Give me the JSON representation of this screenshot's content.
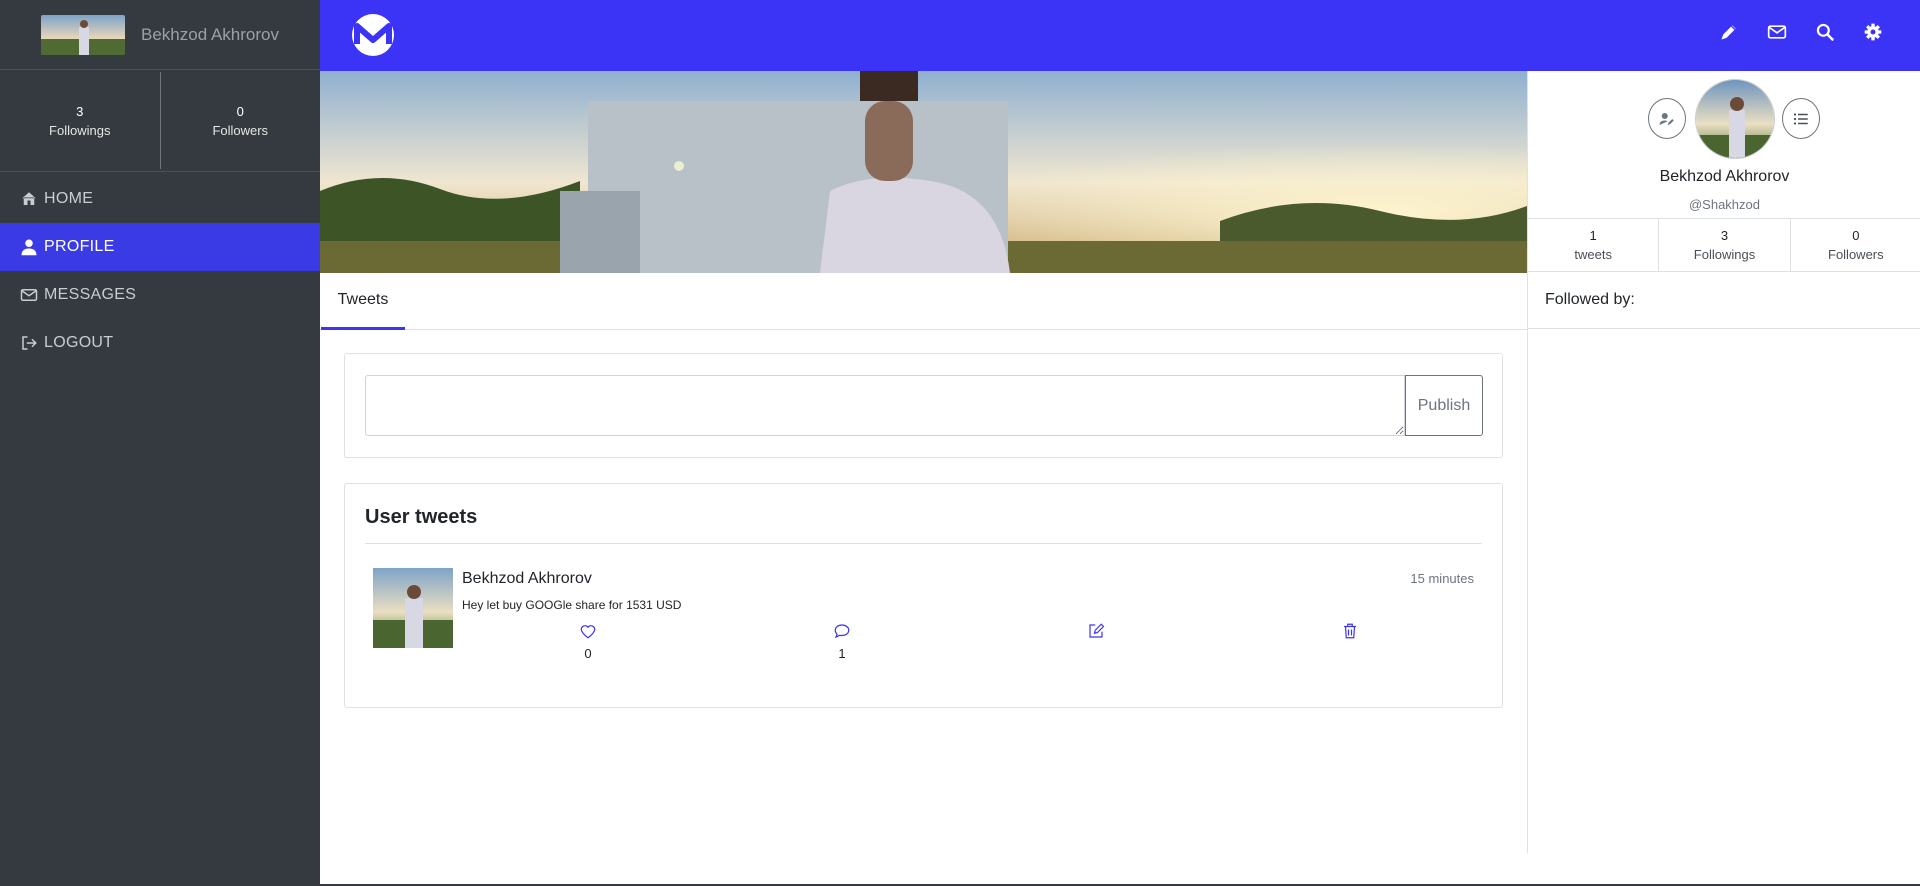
{
  "sidebar": {
    "user_name": "Bekhzod Akhrorov",
    "stats": [
      {
        "value": "3",
        "label": "Followings"
      },
      {
        "value": "0",
        "label": "Followers"
      }
    ],
    "nav": [
      {
        "label": "HOME",
        "icon": "home-icon"
      },
      {
        "label": "PROFILE",
        "icon": "user-icon",
        "active": true
      },
      {
        "label": "MESSAGES",
        "icon": "envelope-icon"
      },
      {
        "label": "LOGOUT",
        "icon": "sign-out-icon"
      }
    ]
  },
  "topbar": {
    "accent_color": "#3b33f6",
    "icons": [
      "pencil-icon",
      "envelope-icon",
      "search-icon",
      "gear-icon"
    ]
  },
  "tabs": {
    "active": "Tweets"
  },
  "composer": {
    "value": "",
    "publish_label": "Publish"
  },
  "tweets": {
    "title": "User tweets",
    "items": [
      {
        "author": "Bekhzod Akhrorov",
        "time": "15 minutes",
        "text": "Hey let buy GOOGle share for 1531 USD",
        "likes": "0",
        "comments": "1"
      }
    ]
  },
  "profile": {
    "name": "Bekhzod Akhrorov",
    "handle": "@Shakhzod",
    "stats": [
      {
        "value": "1",
        "label": "tweets"
      },
      {
        "value": "3",
        "label": "Followings"
      },
      {
        "value": "0",
        "label": "Followers"
      }
    ],
    "followed_by": "Followed by:"
  }
}
